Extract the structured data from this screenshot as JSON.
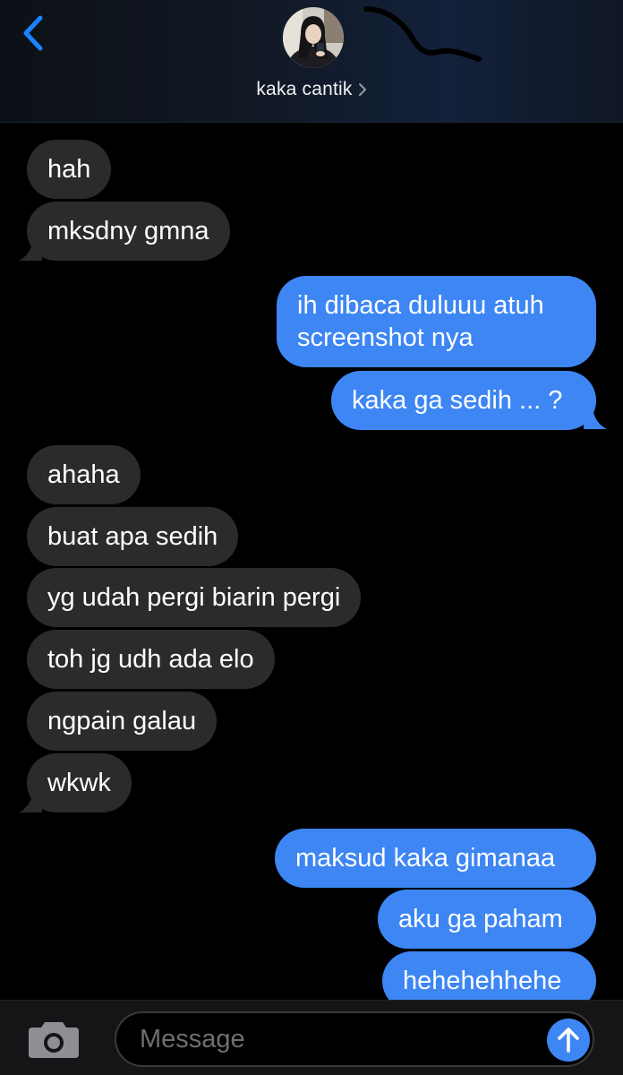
{
  "header": {
    "back_icon": "chevron-left-icon",
    "contact_name": "kaka cantik",
    "disclosure_icon": "chevron-right-icon",
    "accent_color": "#1a82ff"
  },
  "messages": [
    {
      "direction": "incoming",
      "text": "hah"
    },
    {
      "direction": "incoming",
      "text": "mksdny gmna"
    },
    {
      "direction": "outgoing",
      "text": "ih dibaca duluuu atuh screenshot nya"
    },
    {
      "direction": "outgoing",
      "text": "kaka ga sedih ... ?"
    },
    {
      "direction": "incoming",
      "text": "ahaha"
    },
    {
      "direction": "incoming",
      "text": "buat apa sedih"
    },
    {
      "direction": "incoming",
      "text": "yg udah pergi biarin pergi"
    },
    {
      "direction": "incoming",
      "text": "toh jg udh ada elo"
    },
    {
      "direction": "incoming",
      "text": "ngpain galau"
    },
    {
      "direction": "incoming",
      "text": "wkwk"
    },
    {
      "direction": "outgoing",
      "text": "maksud kaka gimanaa"
    },
    {
      "direction": "outgoing",
      "text": "aku ga paham"
    },
    {
      "direction": "outgoing",
      "text": "hehehehhehe"
    }
  ],
  "colors": {
    "incoming_bubble": "#2b2b2e",
    "outgoing_bubble": "#3d86f4",
    "background": "#000000"
  },
  "composer": {
    "camera_icon": "camera-icon",
    "placeholder": "Message",
    "send_icon": "arrow-up-icon"
  }
}
